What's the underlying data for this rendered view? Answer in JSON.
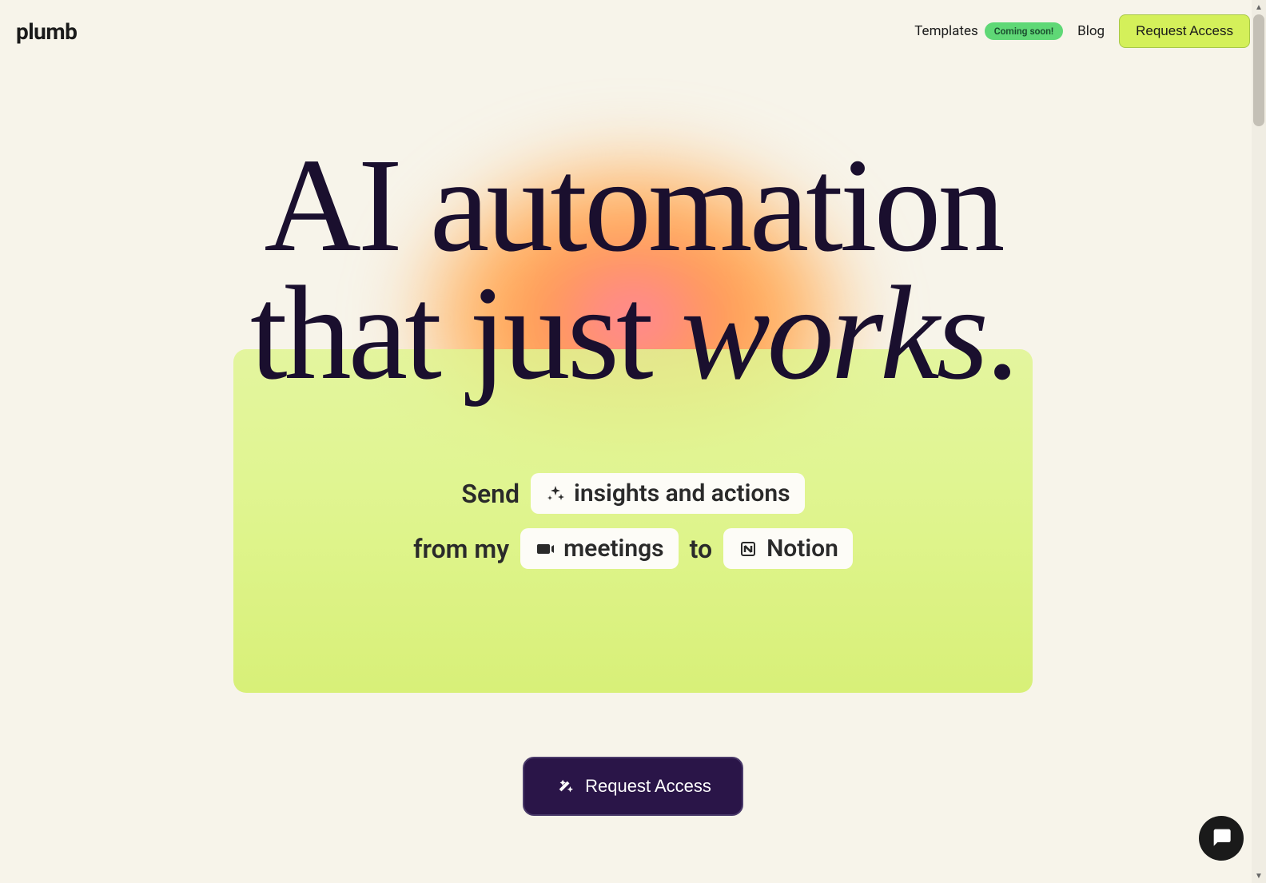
{
  "header": {
    "logo_text": "plumb",
    "nav": {
      "templates_label": "Templates",
      "templates_badge": "Coming soon!",
      "blog_label": "Blog",
      "request_access_label": "Request Access"
    }
  },
  "hero": {
    "headline_line1": "AI automation",
    "headline_line2_part1": "that just ",
    "headline_line2_emphasis": "works",
    "headline_line2_period": "."
  },
  "card": {
    "line1_prefix": "Send",
    "chip1_label": "insights and actions",
    "line2_prefix": "from my",
    "chip2_label": "meetings",
    "line2_mid": "to",
    "chip3_label": "Notion"
  },
  "cta": {
    "label": "Request Access"
  },
  "icons": {
    "sparkle": "sparkle-icon",
    "video": "video-icon",
    "notion": "notion-icon",
    "wand": "wand-icon",
    "chat": "chat-icon"
  }
}
